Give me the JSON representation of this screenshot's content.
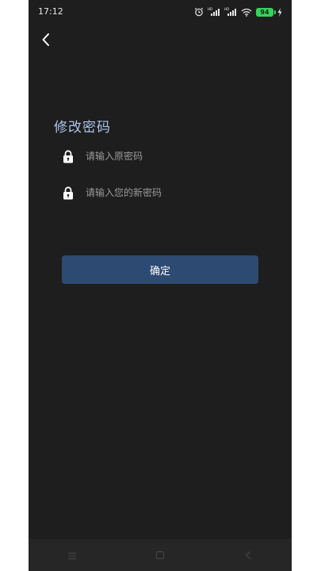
{
  "status_bar": {
    "time": "17:12",
    "battery_level": "94",
    "icons": [
      "alarm-icon",
      "signal-hd-icon",
      "signal-hd-icon",
      "wifi-icon",
      "battery-icon",
      "charging-icon"
    ]
  },
  "header": {
    "back_icon": "chevron-left-icon"
  },
  "page": {
    "title": "修改密码"
  },
  "form": {
    "old_password": {
      "placeholder": "请输入原密码",
      "value": "",
      "icon": "lock-icon"
    },
    "new_password": {
      "placeholder": "请输入您的新密码",
      "value": "",
      "icon": "lock-icon"
    },
    "confirm_label": "确定"
  },
  "nav_bar": {
    "items": [
      "menu-icon",
      "home-square-icon",
      "back-triangle-icon"
    ]
  },
  "colors": {
    "background": "#1e1e1e",
    "title": "#a9c4ec",
    "button": "#2d4a73",
    "battery": "#35d35a"
  }
}
